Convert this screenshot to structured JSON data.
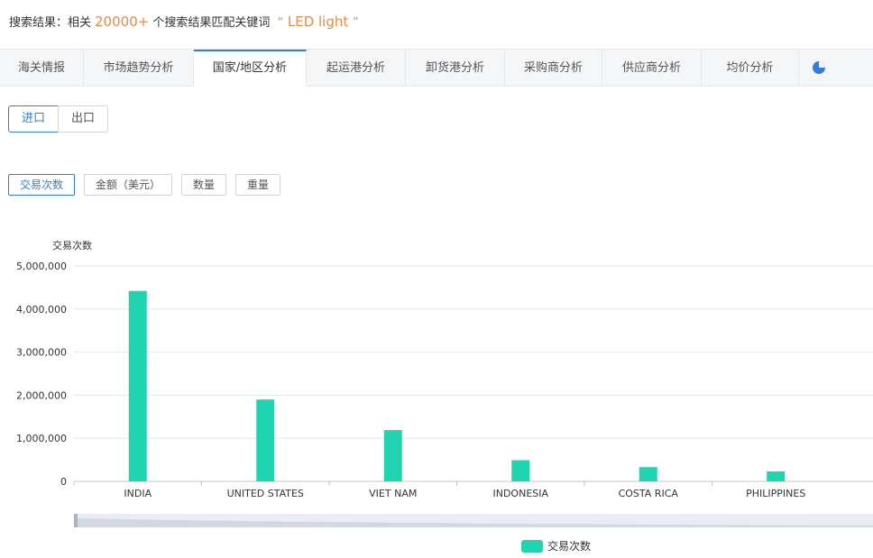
{
  "search": {
    "prefix": "搜索结果：相关",
    "count": "20000+",
    "suffix": "个搜索结果匹配关键词",
    "quote_open": "“",
    "keyword": "LED light",
    "quote_close": "”"
  },
  "tabs": [
    {
      "label": "海关情报"
    },
    {
      "label": "市场趋势分析"
    },
    {
      "label": "国家/地区分析"
    },
    {
      "label": "起运港分析"
    },
    {
      "label": "卸货港分析"
    },
    {
      "label": "采购商分析"
    },
    {
      "label": "供应商分析"
    },
    {
      "label": "均价分析"
    }
  ],
  "active_tab": "国家/地区分析",
  "tab_icon": "pie-chart-icon",
  "direction": {
    "import_label": "进口",
    "export_label": "出口",
    "selected": "进口"
  },
  "metrics": [
    {
      "label": "交易次数"
    },
    {
      "label": "金额（美元）"
    },
    {
      "label": "数量"
    },
    {
      "label": "重量"
    }
  ],
  "selected_metric": "交易次数",
  "colors": {
    "accent": "#2e7ce6",
    "bar": "#20d3b1",
    "highlight": "#f0883e"
  },
  "chart_data": {
    "type": "bar",
    "ylabel": "交易次数",
    "xlabel": "",
    "title": "",
    "categories": [
      "INDIA",
      "UNITED STATES",
      "VIET NAM",
      "INDONESIA",
      "COSTA RICA",
      "PHILIPPINES"
    ],
    "series": [
      {
        "name": "交易次数",
        "values": [
          4420000,
          1900000,
          1190000,
          490000,
          330000,
          230000
        ]
      }
    ],
    "ylim": [
      0,
      5000000
    ],
    "yticks": [
      "0",
      "1,000,000",
      "2,000,000",
      "3,000,000",
      "4,000,000",
      "5,000,000"
    ],
    "grid": true,
    "legend": "bottom"
  }
}
